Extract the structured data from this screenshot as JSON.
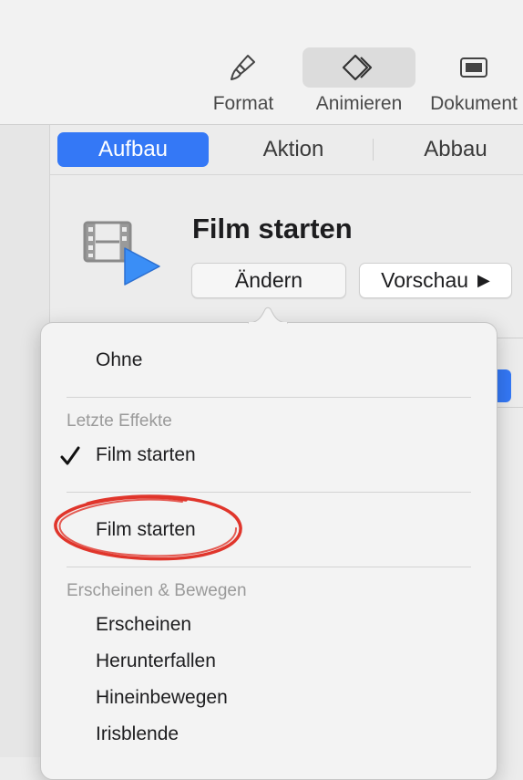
{
  "toolbar": {
    "format_label": "Format",
    "animate_label": "Animieren",
    "document_label": "Dokument"
  },
  "tabs": {
    "build_in": "Aufbau",
    "action": "Aktion",
    "build_out": "Abbau",
    "active": "Aufbau"
  },
  "effect": {
    "title": "Film starten",
    "change_label": "Ändern",
    "preview_label": "Vorschau",
    "preview_arrow": "▶"
  },
  "menu": {
    "none_label": "Ohne",
    "recent_header": "Letzte Effekte",
    "recent_items": [
      "Film starten",
      "Film starten"
    ],
    "checked_item": "Film starten",
    "appear_header": "Erscheinen & Bewegen",
    "appear_items": [
      "Erscheinen",
      "Herunterfallen",
      "Hineinbewegen",
      "Irisblende"
    ]
  },
  "colors": {
    "accent": "#3478f6",
    "annotation": "#e0352b"
  },
  "icons": {
    "format": "paintbrush-icon",
    "animate": "diamond-animate-icon",
    "document": "document-panel-icon",
    "effect": "film-play-icon",
    "check": "checkmark-icon"
  }
}
